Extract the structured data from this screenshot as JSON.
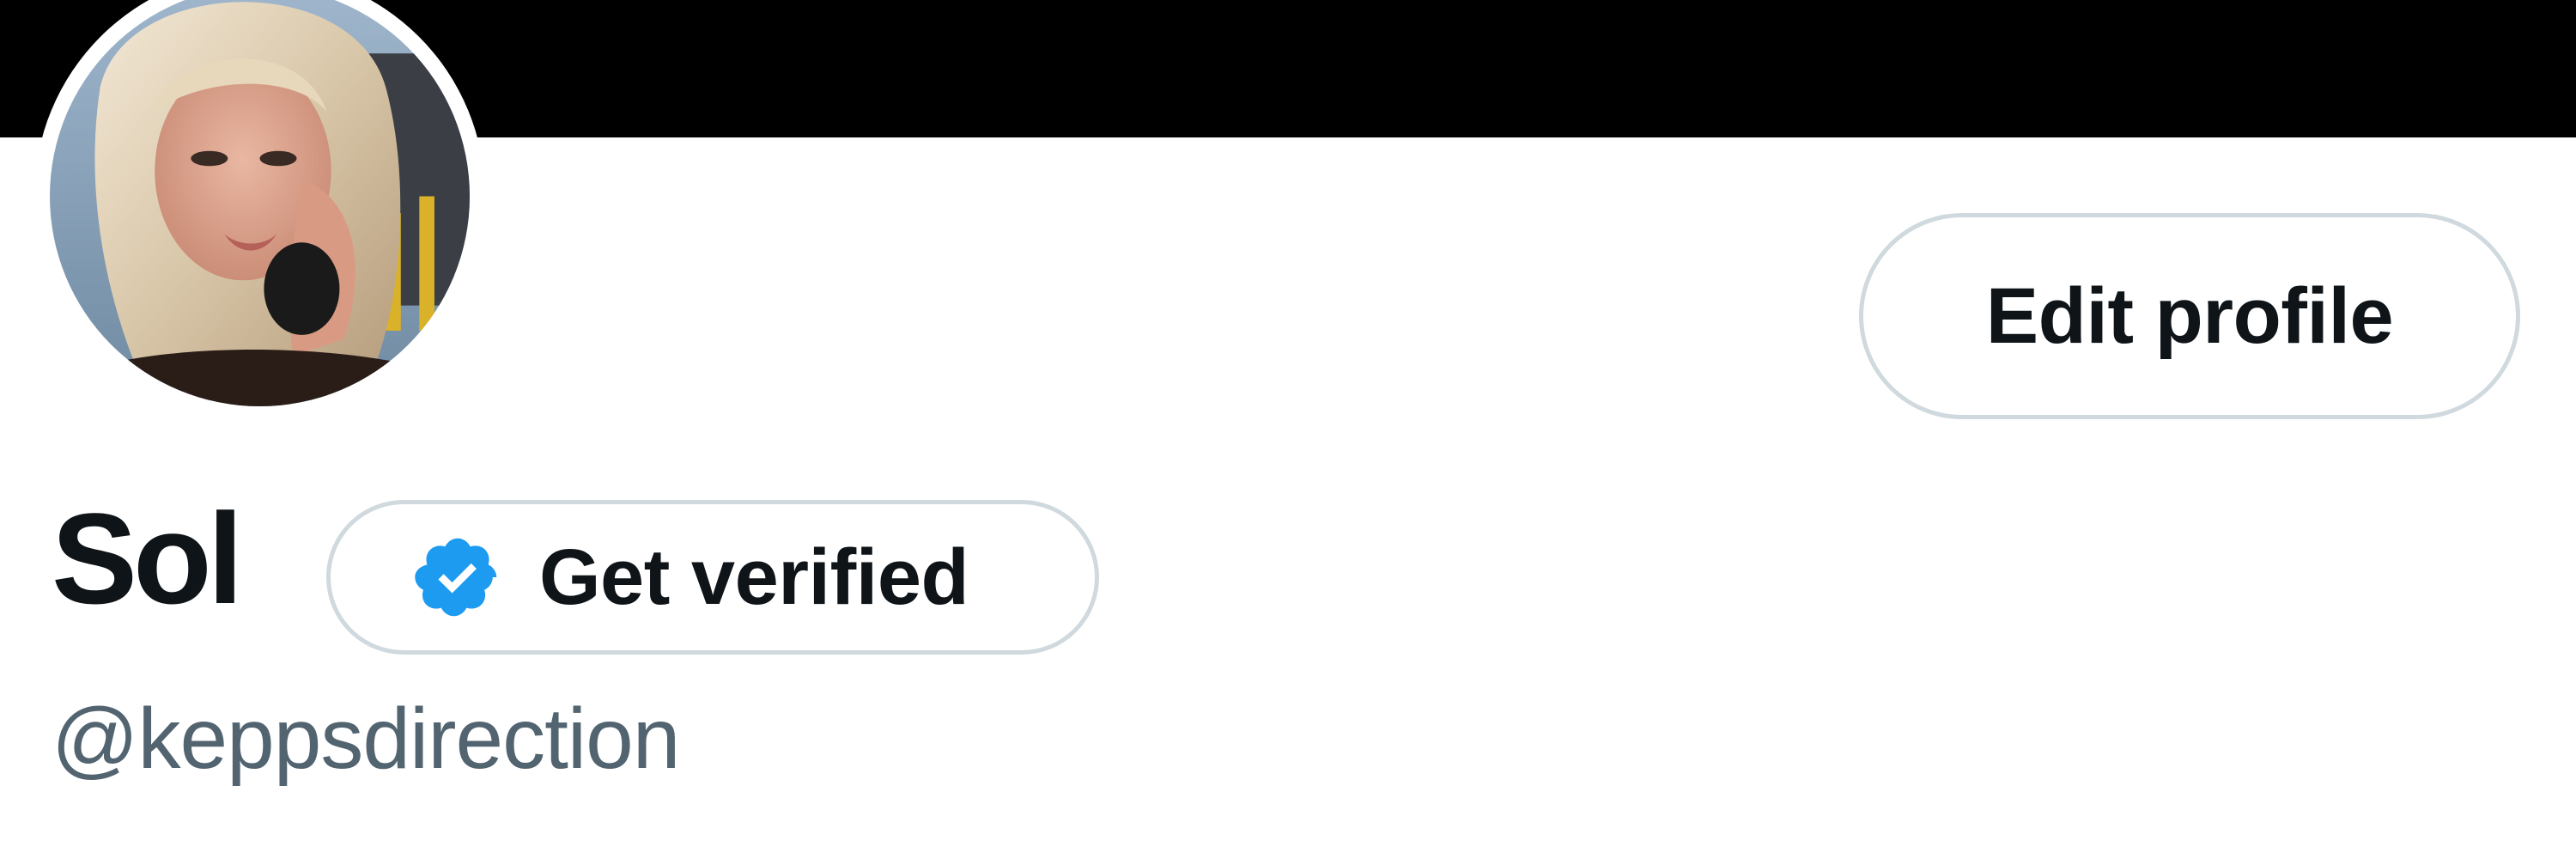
{
  "profile": {
    "display_name": "Sol",
    "handle": "@keppsdirection",
    "avatar_alt": "profile photo"
  },
  "actions": {
    "edit_profile_label": "Edit profile",
    "get_verified_label": "Get verified",
    "verified_icon": "verified-badge-icon"
  },
  "colors": {
    "banner": "#000000",
    "text_primary": "#0f1419",
    "text_secondary": "#536471",
    "button_border": "#cfd9de",
    "verified_blue": "#1d9bf0"
  }
}
